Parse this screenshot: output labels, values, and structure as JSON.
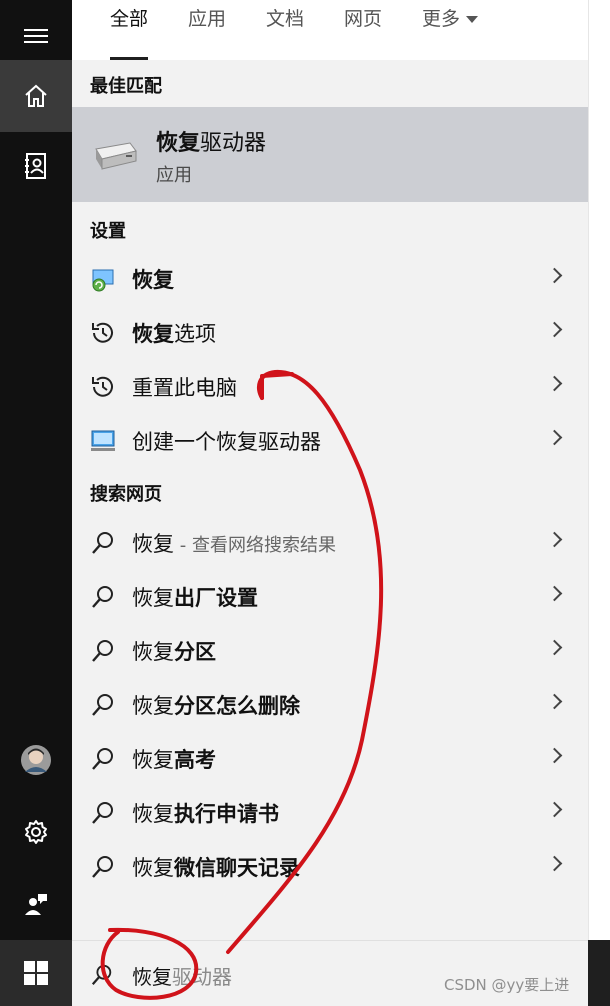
{
  "tabs": [
    {
      "label": "全部",
      "active": true
    },
    {
      "label": "应用",
      "active": false
    },
    {
      "label": "文档",
      "active": false
    },
    {
      "label": "网页",
      "active": false
    },
    {
      "label": "更多",
      "active": false,
      "dropdown": true
    }
  ],
  "best_match": {
    "section_title": "最佳匹配",
    "title_bold": "恢复",
    "title_rest": "驱动器",
    "subtitle": "应用",
    "icon": "drive-icon"
  },
  "settings": {
    "section_title": "设置",
    "items": [
      {
        "bold": "恢复",
        "rest": "",
        "icon": "recovery-icon"
      },
      {
        "bold": "恢复",
        "rest": "选项",
        "icon": "history-icon"
      },
      {
        "bold": "",
        "rest": "重置此电脑",
        "icon": "history-icon"
      },
      {
        "bold": "",
        "rest": "创建一个恢复驱动器",
        "icon": "monitor-icon"
      }
    ]
  },
  "web": {
    "section_title": "搜索网页",
    "items": [
      {
        "normal": "恢复",
        "bold": "",
        "hint": " - 查看网络搜索结果"
      },
      {
        "normal": "恢复",
        "bold": "出厂设置",
        "hint": ""
      },
      {
        "normal": "恢复",
        "bold": "分区",
        "hint": ""
      },
      {
        "normal": "恢复",
        "bold": "分区怎么删除",
        "hint": ""
      },
      {
        "normal": "恢复",
        "bold": "高考",
        "hint": ""
      },
      {
        "normal": "恢复",
        "bold": "执行申请书",
        "hint": ""
      },
      {
        "normal": "恢复",
        "bold": "微信聊天记录",
        "hint": ""
      }
    ]
  },
  "search": {
    "typed": "恢复",
    "suggestion": "驱动器"
  },
  "watermark": "CSDN @yy要上进",
  "rail": [
    "hamburger-icon",
    "home-icon",
    "notebook-icon",
    "avatar",
    "gear-icon",
    "feedback-icon",
    "windows-start-icon"
  ],
  "colors": {
    "annotation": "#d0131a",
    "highlight": "#ccced3",
    "rail": "#111111"
  }
}
